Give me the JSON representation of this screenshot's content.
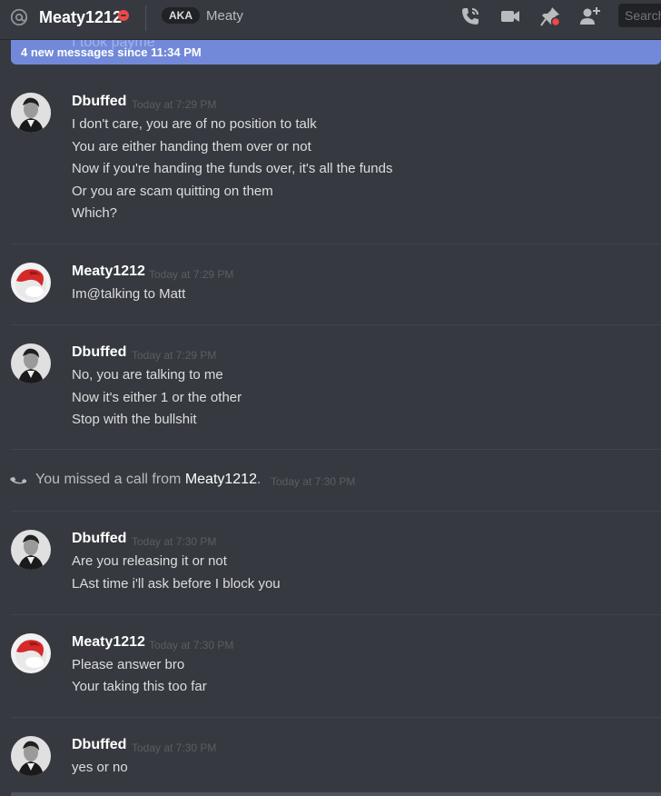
{
  "header": {
    "title": "Meaty1212",
    "status": "do-not-disturb",
    "aka_label": "AKA",
    "aka_name": "Meaty",
    "search_placeholder": "Search",
    "icons": [
      "at-icon",
      "call-icon",
      "video-icon",
      "pin-icon",
      "add-friend-icon"
    ]
  },
  "new_messages": {
    "ghost_text": "I took payme",
    "label": "4 new messages since 11:34 PM"
  },
  "messages": [
    {
      "author": "Dbuffed",
      "time": "Today at 7:29 PM",
      "lines": [
        "I don't care, you are of no position to talk",
        "You are either handing them over or not",
        "Now if you're handing the funds over, it's all the funds",
        "Or you are scam quitting on them",
        "Which?"
      ]
    },
    {
      "author": "Meaty1212",
      "time": "Today at 7:29 PM",
      "lines": [
        "Im@talking to Matt"
      ]
    },
    {
      "author": "Dbuffed",
      "time": "Today at 7:29 PM",
      "lines": [
        "No, you are talking to me",
        "Now it's either 1 or the other",
        "Stop with the bullshit"
      ]
    },
    {
      "author": "Dbuffed",
      "time": "Today at 7:30 PM",
      "lines": [
        "Are you releasing it or not",
        "LAst time i'll ask before I block you"
      ]
    },
    {
      "author": "Meaty1212",
      "time": "Today at 7:30 PM",
      "lines": [
        "Please answer bro",
        "Your taking this too far"
      ]
    },
    {
      "author": "Dbuffed",
      "time": "Today at 7:30 PM",
      "lines": [
        "yes or no"
      ]
    }
  ],
  "missed_call": {
    "prefix": "You missed a call from ",
    "name": "Meaty1212",
    "suffix": ".",
    "time": "Today at 7:30 PM"
  },
  "colors": {
    "background": "#36393f",
    "accent": "#7289da",
    "dnd": "#f04747"
  }
}
